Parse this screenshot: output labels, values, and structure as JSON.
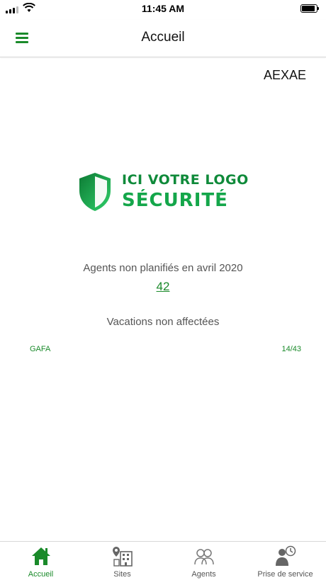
{
  "status_bar": {
    "time": "11:45 AM"
  },
  "header": {
    "title": "Accueil"
  },
  "company": {
    "name": "AEXAE"
  },
  "logo": {
    "line1": "ICI VOTRE LOGO",
    "line2": "SÉCURITÉ"
  },
  "stats": {
    "agents_label": "Agents non planifiés en avril 2020",
    "agents_count": "42",
    "vacations_label": "Vacations non affectées"
  },
  "vacations": [
    {
      "name": "GAFA",
      "count": "14/43"
    }
  ],
  "tabs": [
    {
      "label": "Accueil",
      "icon": "home-icon",
      "active": true
    },
    {
      "label": "Sites",
      "icon": "building-icon",
      "active": false
    },
    {
      "label": "Agents",
      "icon": "agents-icon",
      "active": false
    },
    {
      "label": "Prise de service",
      "icon": "service-clock-icon",
      "active": false
    }
  ],
  "colors": {
    "accent": "#1a8a2a",
    "logo_green": "#14a64a",
    "divider": "#d8d8d8"
  }
}
